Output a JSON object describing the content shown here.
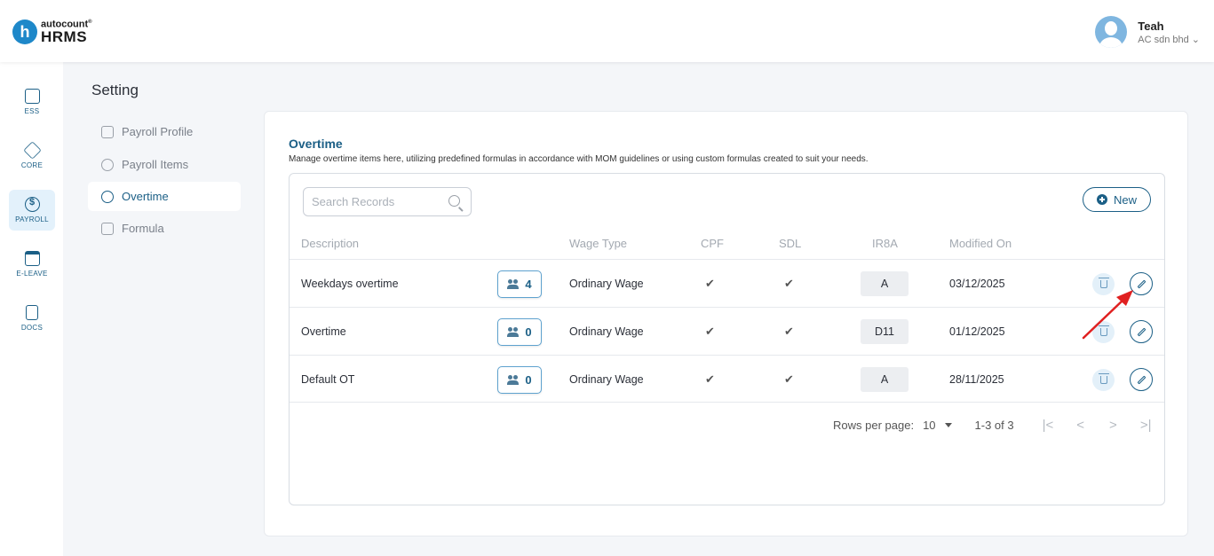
{
  "brand": {
    "logo_letter": "h",
    "logo_top": "autocount",
    "logo_mark": "®",
    "logo_bottom": "HRMS"
  },
  "user": {
    "name": "Teah",
    "company": "AC sdn bhd ⌄"
  },
  "sidenav": [
    {
      "label": "ESS",
      "icon": "ess-icon"
    },
    {
      "label": "CORE",
      "icon": "core-icon"
    },
    {
      "label": "PAYROLL",
      "icon": "payroll-icon",
      "active": true
    },
    {
      "label": "E-LEAVE",
      "icon": "calendar-icon"
    },
    {
      "label": "DOCS",
      "icon": "docs-icon"
    }
  ],
  "page": {
    "title": "Setting"
  },
  "submenu": [
    {
      "label": "Payroll Profile"
    },
    {
      "label": "Payroll Items"
    },
    {
      "label": "Overtime",
      "active": true
    },
    {
      "label": "Formula"
    }
  ],
  "section": {
    "title": "Overtime",
    "description": "Manage overtime items here, utilizing predefined formulas in accordance with MOM guidelines or using custom formulas created to suit your needs."
  },
  "search": {
    "placeholder": "Search Records"
  },
  "new_button": {
    "label": "New"
  },
  "table": {
    "headers": {
      "description": "Description",
      "wage_type": "Wage Type",
      "cpf": "CPF",
      "sdl": "SDL",
      "ir8a": "IR8A",
      "modified_on": "Modified On"
    },
    "rows": [
      {
        "description": "Weekdays overtime",
        "employees": "4",
        "wage_type": "Ordinary Wage",
        "cpf": "✔",
        "sdl": "✔",
        "ir8a": "A",
        "modified_on": "03/12/2025"
      },
      {
        "description": "Overtime",
        "employees": "0",
        "wage_type": "Ordinary Wage",
        "cpf": "✔",
        "sdl": "✔",
        "ir8a": "D11",
        "modified_on": "01/12/2025"
      },
      {
        "description": "Default OT",
        "employees": "0",
        "wage_type": "Ordinary Wage",
        "cpf": "✔",
        "sdl": "✔",
        "ir8a": "A",
        "modified_on": "28/11/2025"
      }
    ]
  },
  "pagination": {
    "rows_per_page_label": "Rows per page:",
    "rows_per_page": "10",
    "range": "1-3 of 3",
    "first": "|<",
    "prev": "<",
    "next": ">",
    "last": ">|"
  },
  "colors": {
    "primary": "#1b5f86",
    "accent": "#1e88c9",
    "annotation_arrow": "#e02020"
  }
}
